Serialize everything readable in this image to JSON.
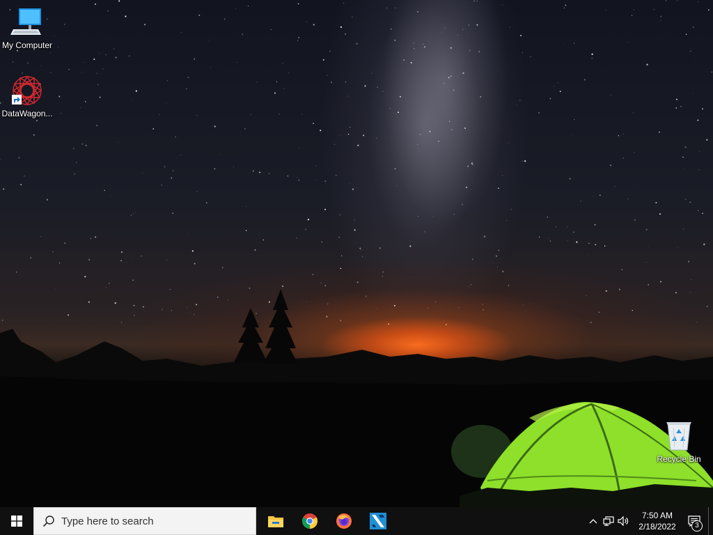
{
  "desktop": {
    "icons": [
      {
        "label": "My Computer",
        "icon": "computer-icon"
      },
      {
        "label": "DataWagon...",
        "icon": "datawagon-icon"
      },
      {
        "label": "Recycle Bin",
        "icon": "recycle-bin-icon"
      }
    ]
  },
  "taskbar": {
    "start_icon": "windows-logo-icon",
    "search_placeholder": "Type here to search",
    "apps": [
      {
        "name": "File Explorer",
        "icon": "file-explorer-icon"
      },
      {
        "name": "Google Chrome",
        "icon": "chrome-icon"
      },
      {
        "name": "Firefox",
        "icon": "firefox-icon"
      },
      {
        "name": "Kodi-like app",
        "icon": "app-icon"
      }
    ],
    "tray": {
      "clock_time": "7:50 AM",
      "clock_date": "2/18/2022",
      "notification_count": "3"
    }
  },
  "colors": {
    "taskbar": "#101010",
    "search_bg": "#f3f3f3",
    "tent_green": "#7ed321",
    "windows_blue": "#0078d7"
  }
}
